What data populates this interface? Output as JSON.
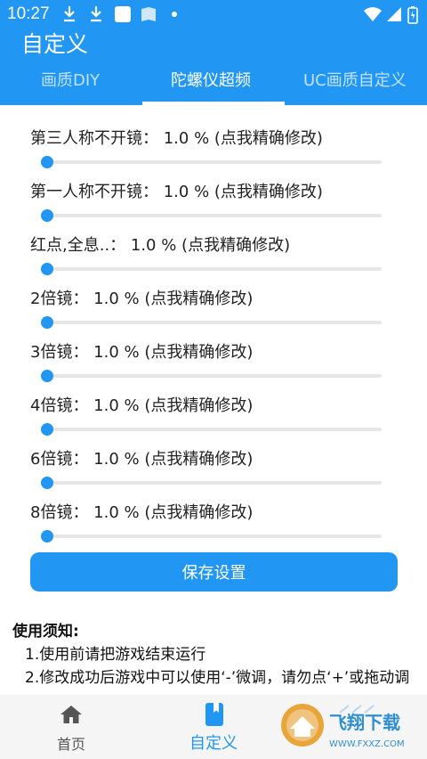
{
  "status_bar": {
    "time": "10:27"
  },
  "app": {
    "title": "自定义"
  },
  "tabs": [
    {
      "label": "画质DIY"
    },
    {
      "label": "陀螺仪超频"
    },
    {
      "label": "UC画质自定义"
    }
  ],
  "settings": [
    {
      "label": "第三人称不开镜：  1.0 %  (点我精确修改)",
      "value_percent": 1.0
    },
    {
      "label": "第一人称不开镜：  1.0 %  (点我精确修改)",
      "value_percent": 1.0
    },
    {
      "label": "红点,全息..：  1.0 %  (点我精确修改)",
      "value_percent": 1.0
    },
    {
      "label": "2倍镜：  1.0 %  (点我精确修改)",
      "value_percent": 1.0
    },
    {
      "label": "3倍镜：  1.0 %  (点我精确修改)",
      "value_percent": 1.0
    },
    {
      "label": "4倍镜：  1.0 %  (点我精确修改)",
      "value_percent": 1.0
    },
    {
      "label": "6倍镜：  1.0 %  (点我精确修改)",
      "value_percent": 1.0
    },
    {
      "label": "8倍镜：  1.0 %  (点我精确修改)",
      "value_percent": 1.0
    }
  ],
  "save_button": {
    "label": "保存设置"
  },
  "notice": {
    "title": "使用须知:",
    "lines": [
      "1.使用前请把游戏结束运行",
      "2.修改成功后游戏中可以使用‘-’微调，请勿点‘+’或拖动调"
    ]
  },
  "bottom_nav": [
    {
      "label": "首页",
      "icon": "home-icon"
    },
    {
      "label": "自定义",
      "icon": "book-icon"
    }
  ],
  "watermark": {
    "brand": "飞翔下载",
    "url": "WWW.FXXZ.COM"
  },
  "colors": {
    "primary": "#2196f3",
    "track": "#e6e6e6",
    "nav_bg": "#f5f5f5"
  }
}
